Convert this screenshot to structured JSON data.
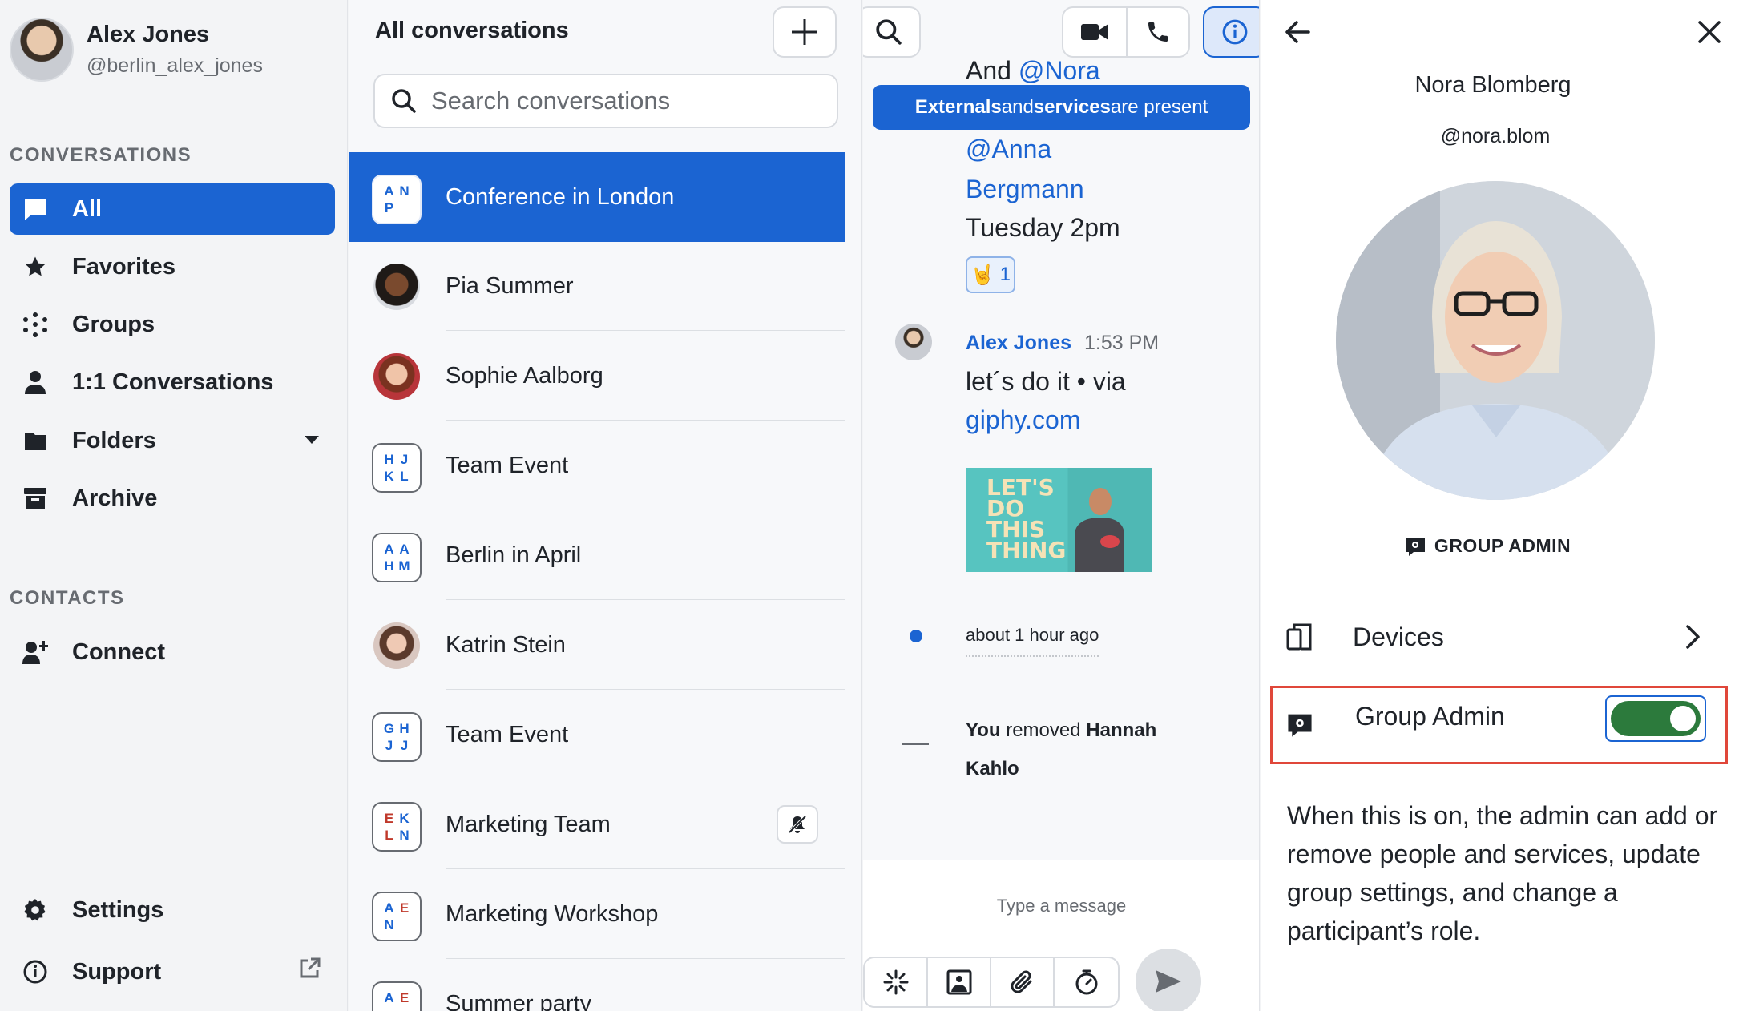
{
  "colors": {
    "accent": "#1b64d2",
    "toggle_on": "#2c7a3c",
    "highlight_border": "#e0473a",
    "initial_blue": "#1b64d2",
    "initial_red": "#c0392b"
  },
  "user": {
    "name": "Alex Jones",
    "handle": "@berlin_alex_jones"
  },
  "sidebar": {
    "conversations_title": "CONVERSATIONS",
    "items": [
      {
        "label": "All",
        "icon": "chat-bubble-icon"
      },
      {
        "label": "Favorites",
        "icon": "star-icon"
      },
      {
        "label": "Groups",
        "icon": "groups-icon"
      },
      {
        "label": "1:1 Conversations",
        "icon": "person-icon"
      },
      {
        "label": "Folders",
        "icon": "folder-icon"
      },
      {
        "label": "Archive",
        "icon": "archive-icon"
      }
    ],
    "contacts_title": "CONTACTS",
    "connect_label": "Connect",
    "settings_label": "Settings",
    "support_label": "Support"
  },
  "conversation_list": {
    "title": "All conversations",
    "search_placeholder": "Search conversations",
    "items": [
      {
        "name": "Conference in London",
        "initials": [
          "A",
          "N",
          "P",
          ""
        ]
      },
      {
        "name": "Pia Summer"
      },
      {
        "name": "Sophie Aalborg"
      },
      {
        "name": "Team Event",
        "initials": [
          "H",
          "J",
          "K",
          "L"
        ]
      },
      {
        "name": "Berlin in April",
        "initials": [
          "A",
          "A",
          "H",
          "M"
        ]
      },
      {
        "name": "Katrin Stein"
      },
      {
        "name": "Team Event",
        "initials": [
          "G",
          "H",
          "J",
          "J"
        ]
      },
      {
        "name": "Marketing Team",
        "initials": [
          "E",
          "K",
          "L",
          "N"
        ]
      },
      {
        "name": "Marketing Workshop",
        "initials": [
          "A",
          "E",
          "N",
          ""
        ]
      },
      {
        "name": "Summer party",
        "initials": [
          "A",
          "E",
          "",
          ""
        ]
      }
    ]
  },
  "chat": {
    "banner": {
      "part1": "Externals",
      "part2": " and ",
      "part3": "services",
      "part4": " are present"
    },
    "message1": {
      "line0_prefix": "And ",
      "line0_mention": "@Nora",
      "mention_anna": "@Anna",
      "mention_bergmann": "Bergmann",
      "line_time": "Tuesday 2pm",
      "reaction_emoji": "🤘",
      "reaction_count": "1"
    },
    "message2": {
      "sender": "Alex Jones",
      "time": "1:53 PM",
      "text_line1": "let´s do it • via",
      "text_link": "giphy.com",
      "gif_text": "LET'S DO THIS THING"
    },
    "status": "about 1 hour ago",
    "system_message": {
      "you": "You",
      "action": " removed ",
      "person": "Hannah Kahlo"
    },
    "composer_placeholder": "Type a message"
  },
  "details": {
    "name": "Nora Blomberg",
    "handle": "@nora.blom",
    "role_badge": "GROUP ADMIN",
    "devices_label": "Devices",
    "group_admin_label": "Group Admin",
    "group_admin_on": true,
    "description": "When this is on, the admin can add or remove people and services, update group settings, and change a participant’s role."
  }
}
